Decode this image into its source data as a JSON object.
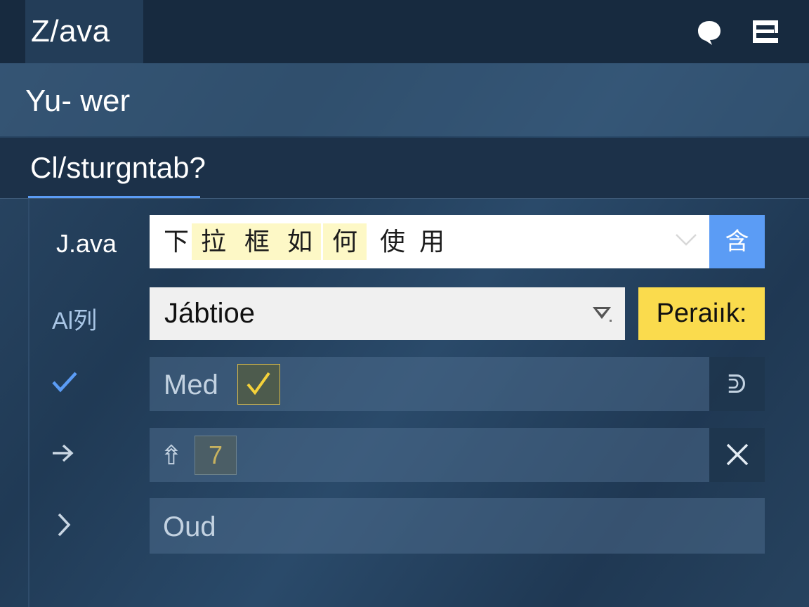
{
  "header": {
    "app_title": "Z/ava",
    "icons": [
      "chat-bubble-icon",
      "window-icon"
    ]
  },
  "section_1": {
    "title": "Yu- wer"
  },
  "section_2": {
    "title": "Cl/sturgntab?"
  },
  "rows": {
    "row1": {
      "label": "J.ava",
      "combo_chars": [
        "下",
        "拉",
        "框",
        "如",
        "何",
        "使",
        "用"
      ],
      "button_glyph": "含"
    },
    "row2": {
      "label": "Al列",
      "select_value": "Jábtioe",
      "button_label": "Peraiık:"
    },
    "row3": {
      "icon": "checkmark-icon",
      "field_text": "Med",
      "checkbox_icon": "check-icon",
      "side_glyph": "ᕲ"
    },
    "row4": {
      "icon": "arrow-right-icon",
      "field_glyph": "⇮",
      "box_value": "7",
      "side_icon": "close-icon"
    },
    "row5": {
      "icon": "chevron-right-icon",
      "field_text": "Oud"
    }
  },
  "colors": {
    "accent_blue": "#5b9cf5",
    "accent_yellow": "#fadb4d",
    "highlight": "#fdf8c6",
    "dark_bar": "#172a3f"
  }
}
